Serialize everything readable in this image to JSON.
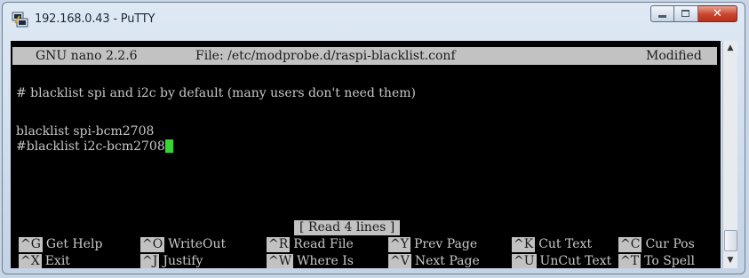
{
  "window": {
    "title": "192.168.0.43 - PuTTY",
    "icon": "putty-icon",
    "controls": {
      "minimize": "minimize-icon",
      "maximize": "maximize-icon",
      "close_label": "✕"
    }
  },
  "nano": {
    "header": {
      "program": "GNU nano 2.2.6",
      "file_label": "File: /etc/modprobe.d/raspi-blacklist.conf",
      "state": "Modified"
    },
    "lines": [
      "# blacklist spi and i2c by default (many users don't need them)",
      "",
      "blacklist spi-bcm2708",
      "#blacklist i2c-bcm2708"
    ],
    "status_message": "[ Read 4 lines ]",
    "shortcuts_row1": [
      {
        "key": "^G",
        "label": "Get Help"
      },
      {
        "key": "^O",
        "label": "WriteOut"
      },
      {
        "key": "^R",
        "label": "Read File"
      },
      {
        "key": "^Y",
        "label": "Prev Page"
      },
      {
        "key": "^K",
        "label": "Cut Text"
      },
      {
        "key": "^C",
        "label": "Cur Pos"
      }
    ],
    "shortcuts_row2": [
      {
        "key": "^X",
        "label": "Exit"
      },
      {
        "key": "^J",
        "label": "Justify"
      },
      {
        "key": "^W",
        "label": "Where Is"
      },
      {
        "key": "^V",
        "label": "Next Page"
      },
      {
        "key": "^U",
        "label": "UnCut Text"
      },
      {
        "key": "^T",
        "label": "To Spell"
      }
    ]
  },
  "colors": {
    "terminal_bg": "#000000",
    "terminal_fg": "#c8c8c8",
    "highlight_bg": "#c2c2c2",
    "cursor": "#33d633"
  }
}
